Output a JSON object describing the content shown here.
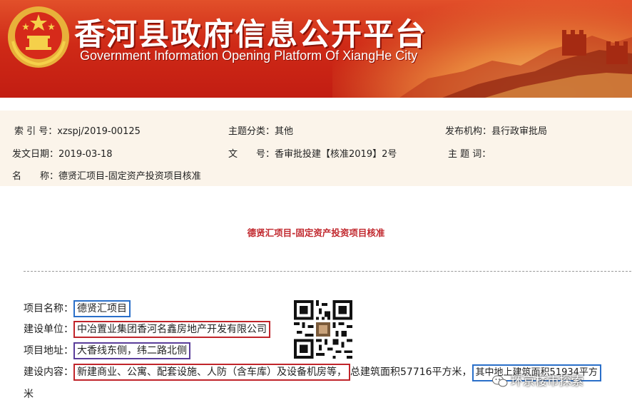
{
  "banner": {
    "title_cn": "香河县政府信息公开平台",
    "title_en": "Government Information Opening Platform Of XiangHe City",
    "colors": {
      "primary": "#c8241a",
      "gold": "#f2c24a"
    }
  },
  "meta": {
    "index_label": "索 引 号：",
    "index_value": "xzspj/2019-00125",
    "topic_label": "主题分类：",
    "topic_value": "其他",
    "publisher_label": "发布机构：",
    "publisher_value": "县行政审批局",
    "date_label": "发文日期：",
    "date_value": "2019-03-18",
    "docno_label": "文　　号：",
    "docno_value": "香审批投建【核准2019】2号",
    "subject_label": "主 题 词：",
    "subject_value": "",
    "name_label": "名　　称：",
    "name_value": "德贤汇项目-固定资产投资项目核准"
  },
  "article": {
    "title": "德贤汇项目-固定资产投资项目核准",
    "project_name_label": "项目名称：",
    "project_name": "德贤汇项目",
    "unit_label": "建设单位：",
    "unit": "中冶置业集团香河名鑫房地产开发有限公司",
    "address_label": "项目地址：",
    "address": "大香线东侧，纬二路北侧",
    "content_label": "建设内容：",
    "content_boxed": "新建商业、公寓、配套设施、人防（含车库）及设备机房等，",
    "content_area": "总建筑面积57716平方米，",
    "content_above": "其中地上建筑面积51934平方",
    "content_wrap": "米"
  },
  "watermark": {
    "text": "环京楼市探索"
  }
}
